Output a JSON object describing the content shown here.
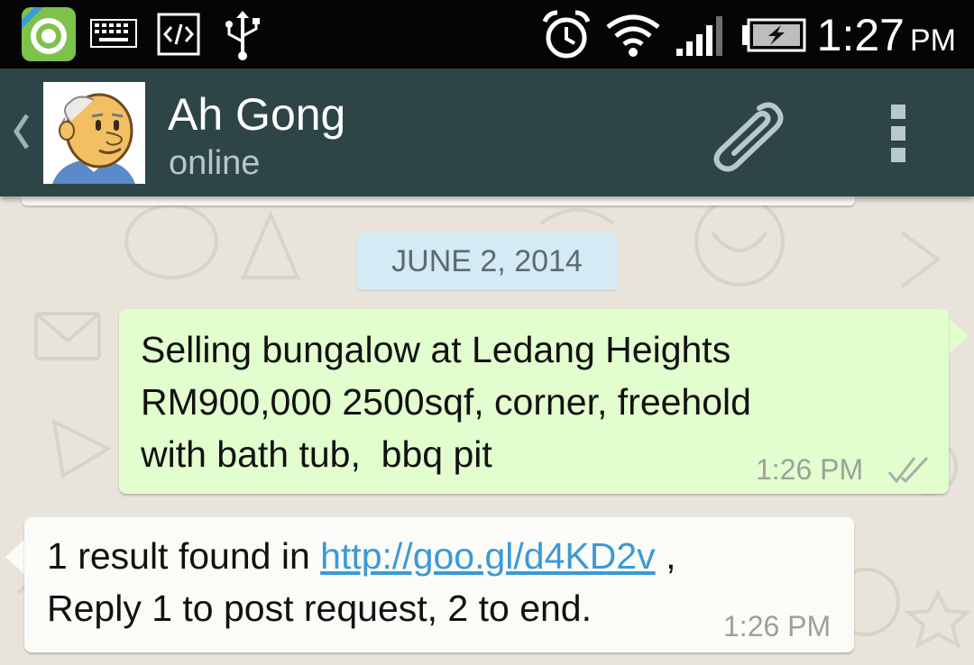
{
  "status_bar": {
    "icons": [
      "pro-app-icon",
      "keyboard-icon",
      "code-icon",
      "usb-icon",
      "alarm-icon",
      "wifi-icon",
      "signal-icon",
      "battery-charging-icon"
    ],
    "time": "1:27",
    "ampm": "PM"
  },
  "header": {
    "contact_name": "Ah Gong",
    "contact_status": "online",
    "icons": [
      "back-chevron-icon",
      "avatar",
      "paperclip-icon",
      "overflow-menu-icon"
    ]
  },
  "chat": {
    "date_divider": "JUNE 2, 2014",
    "messages": [
      {
        "direction": "outgoing",
        "lines": [
          "Selling bungalow at Ledang Heights",
          "RM900,000 2500sqf, corner, freehold",
          "with bath tub,  bbq pit"
        ],
        "time": "1:26 PM",
        "status_icon": "double-check-icon"
      },
      {
        "direction": "incoming",
        "line1_prefix": "1 result found in ",
        "link": "http://goo.gl/d4KD2v",
        "line1_suffix": " ,",
        "line2": "Reply 1 to post request, 2 to end.",
        "time": "1:26 PM"
      }
    ]
  },
  "colors": {
    "status_bar_bg": "#050505",
    "action_bar_bg": "#2d4547",
    "outgoing_bubble": "#e2fdce",
    "incoming_bubble": "#fbfbf7",
    "date_pill": "#d4eaf4",
    "link": "#3b9ad6",
    "wallpaper": "#e8e4db"
  }
}
